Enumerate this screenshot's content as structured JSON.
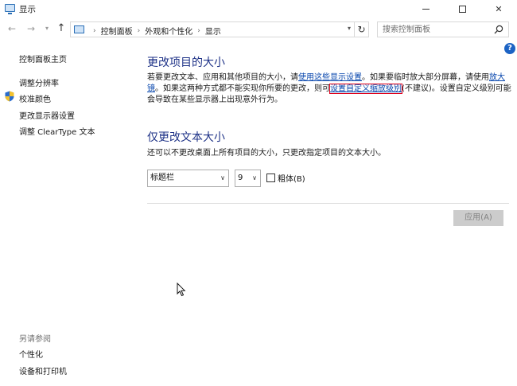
{
  "window": {
    "title": "显示"
  },
  "address": {
    "crumbs": [
      "控制面板",
      "外观和个性化",
      "显示"
    ]
  },
  "search": {
    "placeholder": "搜索控制面板"
  },
  "sidebar": {
    "home": "控制面板主页",
    "items": [
      "调整分辨率",
      "校准颜色",
      "更改显示器设置",
      "调整 ClearType 文本"
    ],
    "see_also_heading": "另请参阅",
    "see_also_items": [
      "个性化",
      "设备和打印机"
    ]
  },
  "main": {
    "section1_title": "更改项目的大小",
    "para": {
      "t1": "若要更改文本、应用和其他项目的大小，请",
      "link1": "使用这些显示设置",
      "t2": "。如果要临时放大部分屏幕，请使用",
      "link2": "放大镜",
      "t3": "。如果这两种方式都不能实现你所要的更改，则可",
      "link3": "设置自定义缩放级别",
      "t4": "(不建议)。设置自定义级别可能会导致在某些显示器上出现意外行为。"
    },
    "section2_title": "仅更改文本大小",
    "section2_desc": "还可以不更改桌面上所有项目的大小，只更改指定项目的文本大小。",
    "item_select_value": "标题栏",
    "size_select_value": "9",
    "bold_label": "粗体(B)",
    "bold_checked": false,
    "apply_label": "应用(A)"
  },
  "colors": {
    "heading": "#1e3287",
    "link": "#0645ad",
    "highlight_box": "#e0001b",
    "help_icon": "#1c63c4"
  },
  "icons": {
    "app": "display-icon",
    "search": "search-icon",
    "refresh": "refresh-icon",
    "help": "help-icon",
    "shield": "shield-icon"
  }
}
